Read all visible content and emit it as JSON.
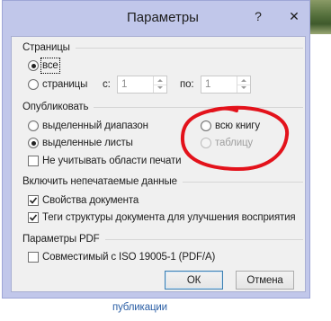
{
  "window": {
    "title": "Параметры",
    "help_label": "?",
    "close_label": "✕"
  },
  "pages": {
    "heading": "Страницы",
    "options": [
      {
        "label": "все",
        "checked": true,
        "focused": true
      },
      {
        "label": "страницы",
        "checked": false
      }
    ],
    "from": {
      "label": "с:",
      "value": "1",
      "disabled": true
    },
    "to": {
      "label": "по:",
      "value": "1",
      "disabled": true
    }
  },
  "publish": {
    "heading": "Опубликовать",
    "options": [
      {
        "label": "выделенный диапазон",
        "checked": false
      },
      {
        "label": "выделенные листы",
        "checked": true
      },
      {
        "label": "всю книгу",
        "checked": false
      },
      {
        "label": "таблицу",
        "checked": false,
        "disabled": true
      }
    ],
    "ignore_print_areas": {
      "label": "Не учитывать области печати",
      "checked": false
    }
  },
  "non_printing": {
    "heading": "Включить непечатаемые данные",
    "document_properties": {
      "label": "Свойства документа",
      "checked": true
    },
    "structure_tags": {
      "label": "Теги структуры документа для улучшения восприятия",
      "checked": true
    }
  },
  "pdf_options": {
    "heading": "Параметры PDF",
    "pdfa": {
      "label": "Совместимый с ISO 19005-1 (PDF/A)",
      "checked": false
    }
  },
  "buttons": {
    "ok": "ОК",
    "cancel": "Отмена"
  },
  "background": {
    "link_text": "публикации"
  },
  "annotation": {
    "color": "#e3121b"
  },
  "colors": {
    "frame": "#c1c7ea",
    "dialog_background": "#f0f0f0",
    "link": "#2a5ea5",
    "default_button_border": "#3c7fb1"
  }
}
